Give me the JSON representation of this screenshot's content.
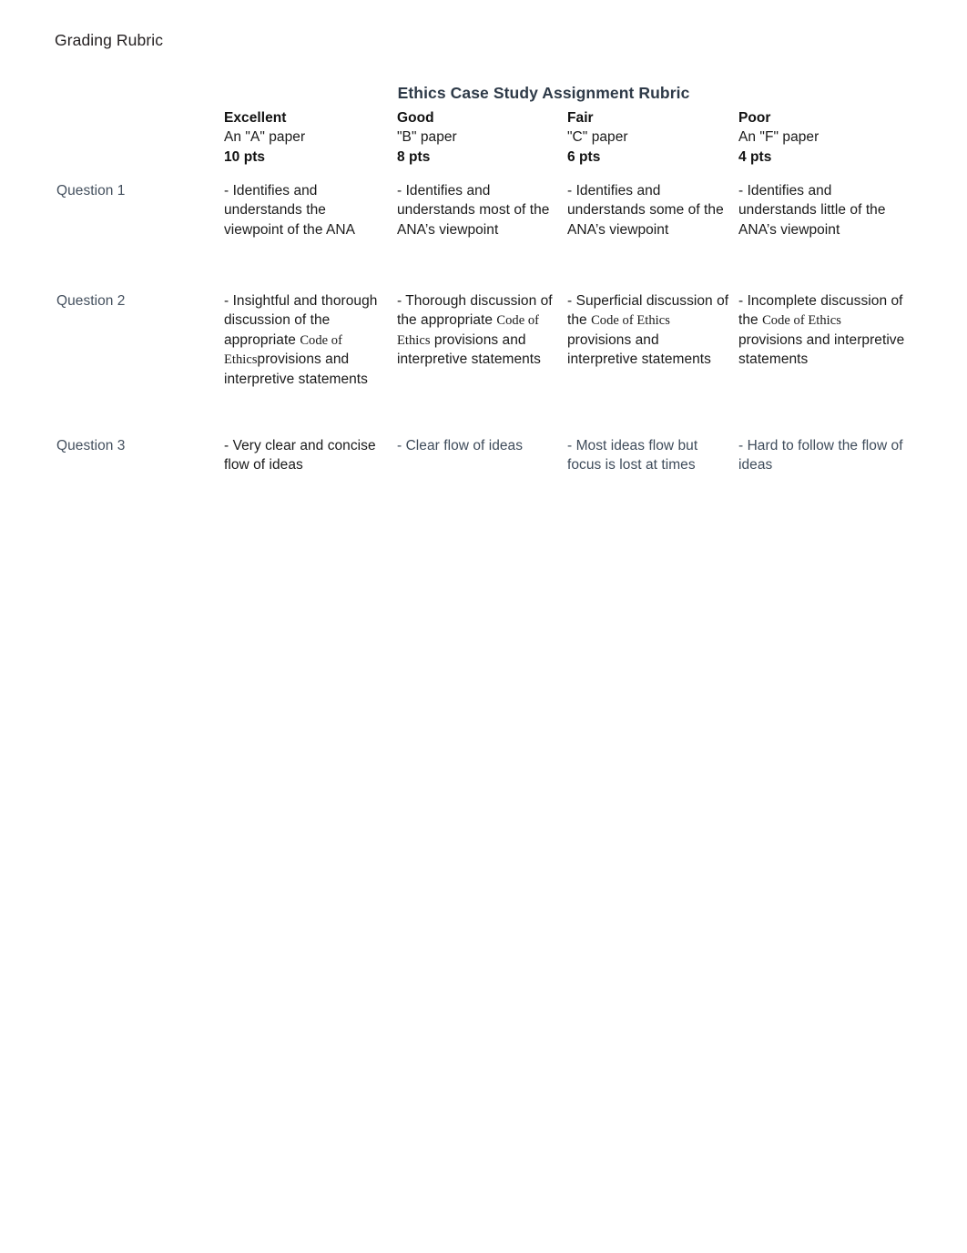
{
  "document": {
    "header_label": "Grading Rubric"
  },
  "rubric": {
    "title": "Ethics Case Study Assignment Rubric",
    "columns": [
      {
        "name": "Excellent",
        "description": "An \"A\" paper",
        "points": "10 pts"
      },
      {
        "name": "Good",
        "description": "\"B\" paper",
        "points": "8 pts"
      },
      {
        "name": "Fair",
        "description": "\"C\" paper",
        "points": "6 pts"
      },
      {
        "name": "Poor",
        "description": "An \"F\" paper",
        "points": "4 pts"
      }
    ],
    "rows": [
      {
        "label": "Question 1",
        "cells": [
          {
            "pre": "- Identifies and understands the viewpoint of the ANA",
            "serif": "",
            "post": ""
          },
          {
            "pre": "- Identifies and understands most of the ANA’s viewpoint",
            "serif": "",
            "post": ""
          },
          {
            "pre": "- Identifies and understands some of the ANA’s viewpoint",
            "serif": "",
            "post": ""
          },
          {
            "pre": "- Identifies and understands little of the ANA’s viewpoint",
            "serif": "",
            "post": ""
          }
        ]
      },
      {
        "label": "Question 2",
        "cells": [
          {
            "pre": "- Insightful and thorough discussion of the appropriate ",
            "serif": "Code of Ethics",
            "post": "provisions and interpretive statements"
          },
          {
            "pre": "- Thorough discussion of the appropriate ",
            "serif": "Code of Ethics",
            "post": " provisions and interpretive statements"
          },
          {
            "pre": "- Superficial discussion of the ",
            "serif": "Code of Ethics",
            "post": " provisions and interpretive statements"
          },
          {
            "pre": "- Incomplete discussion of the ",
            "serif": "Code of Ethics",
            "post": " provisions and interpretive statements"
          }
        ]
      },
      {
        "label": "Question 3",
        "cells": [
          {
            "pre": "- Very clear and concise flow of ideas",
            "serif": "",
            "post": ""
          },
          {
            "pre": "- Clear flow of ideas",
            "serif": "",
            "post": ""
          },
          {
            "pre": "- Most ideas flow but focus is lost at times",
            "serif": "",
            "post": ""
          },
          {
            "pre": "- Hard to follow the flow of ideas",
            "serif": "",
            "post": ""
          }
        ]
      }
    ]
  },
  "colors": {
    "title": "#2e3a48",
    "row_label": "#44505e",
    "body_text": "#1a1a1a",
    "muted_text": "#3f4c5b",
    "page_background": "#ffffff"
  }
}
